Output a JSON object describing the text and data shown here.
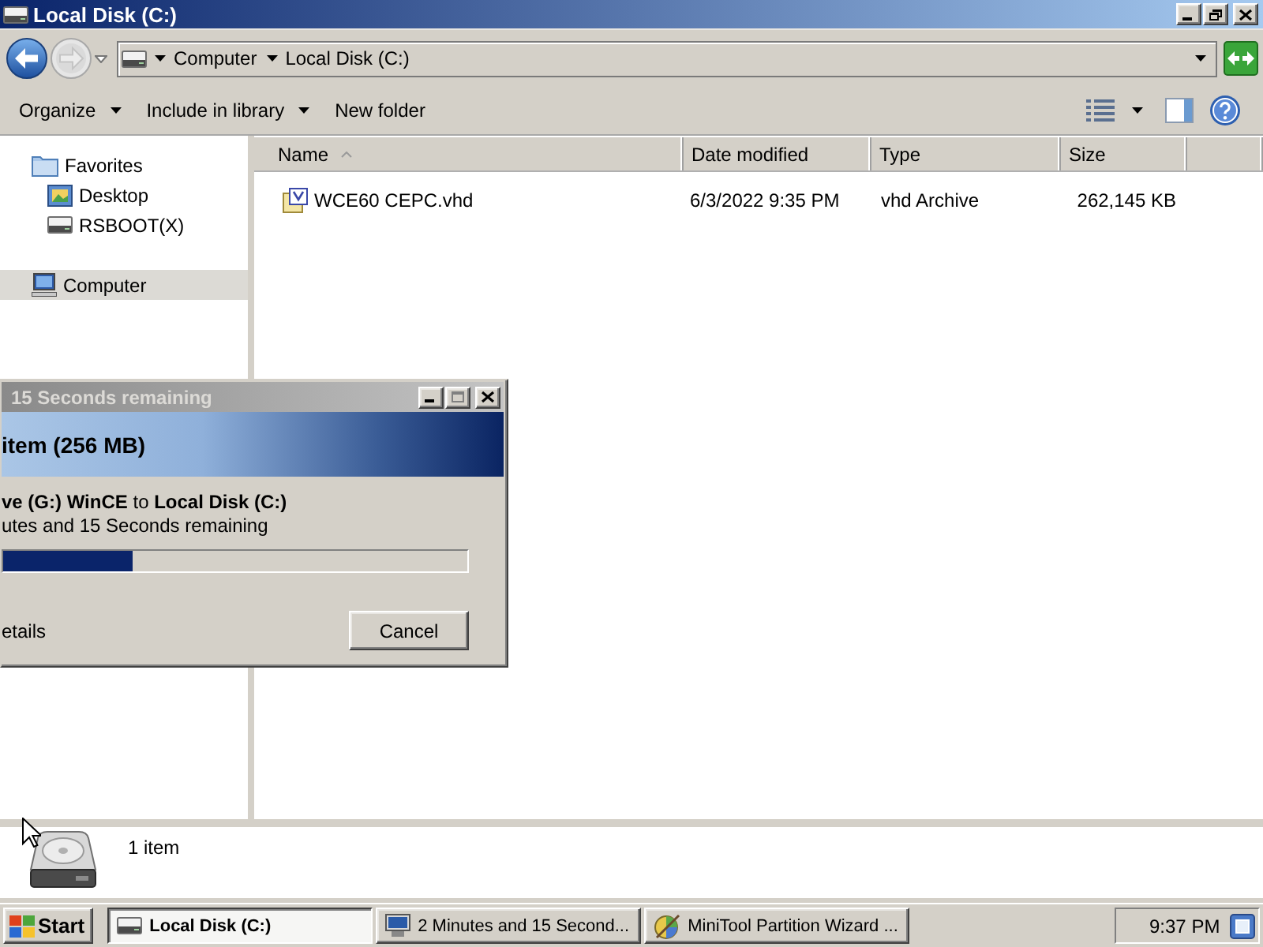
{
  "window": {
    "title": "Local Disk (C:)"
  },
  "address_bar": {
    "crumbs": [
      "Computer",
      "Local Disk (C:)"
    ]
  },
  "toolbar": {
    "items": [
      {
        "label": "Organize",
        "dropdown": true
      },
      {
        "label": "Include in library",
        "dropdown": true
      },
      {
        "label": "New folder",
        "dropdown": false
      }
    ]
  },
  "sidebar": {
    "items": [
      {
        "label": "Favorites",
        "kind": "favorites",
        "selected": false,
        "children": [
          {
            "label": "Desktop",
            "kind": "desktop",
            "selected": false
          },
          {
            "label": "RSBOOT(X)",
            "kind": "drive",
            "selected": false
          }
        ]
      },
      {
        "label": "Computer",
        "kind": "computer",
        "selected": true
      }
    ]
  },
  "file_list": {
    "columns": [
      {
        "label": "Name",
        "sorted": true
      },
      {
        "label": "Date modified",
        "sorted": false
      },
      {
        "label": "Type",
        "sorted": false
      },
      {
        "label": "Size",
        "sorted": false
      }
    ],
    "rows": [
      {
        "name": "WCE60 CEPC.vhd",
        "date_modified": "6/3/2022 9:35 PM",
        "type": "vhd Archive",
        "size": "262,145 KB",
        "selected": false
      }
    ]
  },
  "details_pane": {
    "summary": "1 item"
  },
  "copy_dialog": {
    "title": "15 Seconds remaining",
    "heading": "item (256 MB)",
    "route": "**ve (G:) WinCE** to **Local Disk (C:)**",
    "time_left": "utes and 15 Seconds remaining",
    "progress": {
      "level": 0.28
    },
    "details_toggle": "etails",
    "buttons": [
      "Cancel"
    ]
  },
  "taskbar": {
    "start": "Start",
    "tasks": [
      {
        "label": "Local Disk (C:)",
        "kind": "drive",
        "selected": true
      },
      {
        "label": "2 Minutes and 15 Second...",
        "kind": "copy",
        "selected": false
      },
      {
        "label": "MiniTool Partition Wizard ...",
        "kind": "app",
        "selected": false
      }
    ],
    "clock": "9:37 PM"
  }
}
